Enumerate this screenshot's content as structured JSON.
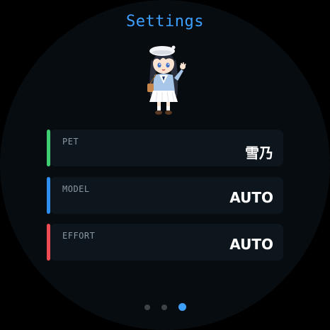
{
  "header": {
    "title": "Settings"
  },
  "pet_avatar": {
    "icon": "chibi-girl-waving-icon"
  },
  "settings": [
    {
      "label": "PET",
      "value": "雪乃",
      "accent_color": "#3ecf73"
    },
    {
      "label": "MODEL",
      "value": "AUTO",
      "accent_color": "#2f8ff0"
    },
    {
      "label": "EFFORT",
      "value": "AUTO",
      "accent_color": "#ee4b55"
    }
  ],
  "pager": {
    "page_count": 3,
    "active_page": 3,
    "active_color": "#3ea0ff",
    "inactive_color": "#3d4349"
  }
}
